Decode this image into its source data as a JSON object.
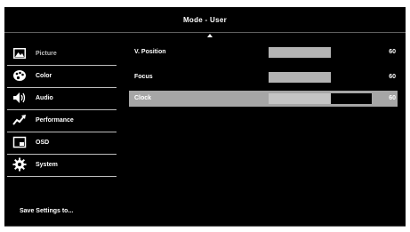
{
  "window": {
    "title": "Mode - User"
  },
  "sidebar": {
    "items": [
      {
        "label": "Picture",
        "icon": "picture-icon",
        "selected": true
      },
      {
        "label": "Color",
        "icon": "palette-icon"
      },
      {
        "label": "Audio",
        "icon": "speaker-icon"
      },
      {
        "label": "Performance",
        "icon": "performance-icon"
      },
      {
        "label": "OSD",
        "icon": "osd-icon"
      },
      {
        "label": "System",
        "icon": "gear-icon"
      }
    ],
    "save_label": "Save Settings to..."
  },
  "settings": [
    {
      "label": "V. Position",
      "value": "60",
      "level": 0.6
    },
    {
      "label": "Focus",
      "value": "60",
      "level": 0.6
    },
    {
      "label": "Clock",
      "value": "60",
      "level": 0.6,
      "highlighted": true
    }
  ],
  "colors": {
    "background": "#000000",
    "highlight": "#a6a6a6",
    "bar_fill": "#b3b3b3"
  }
}
